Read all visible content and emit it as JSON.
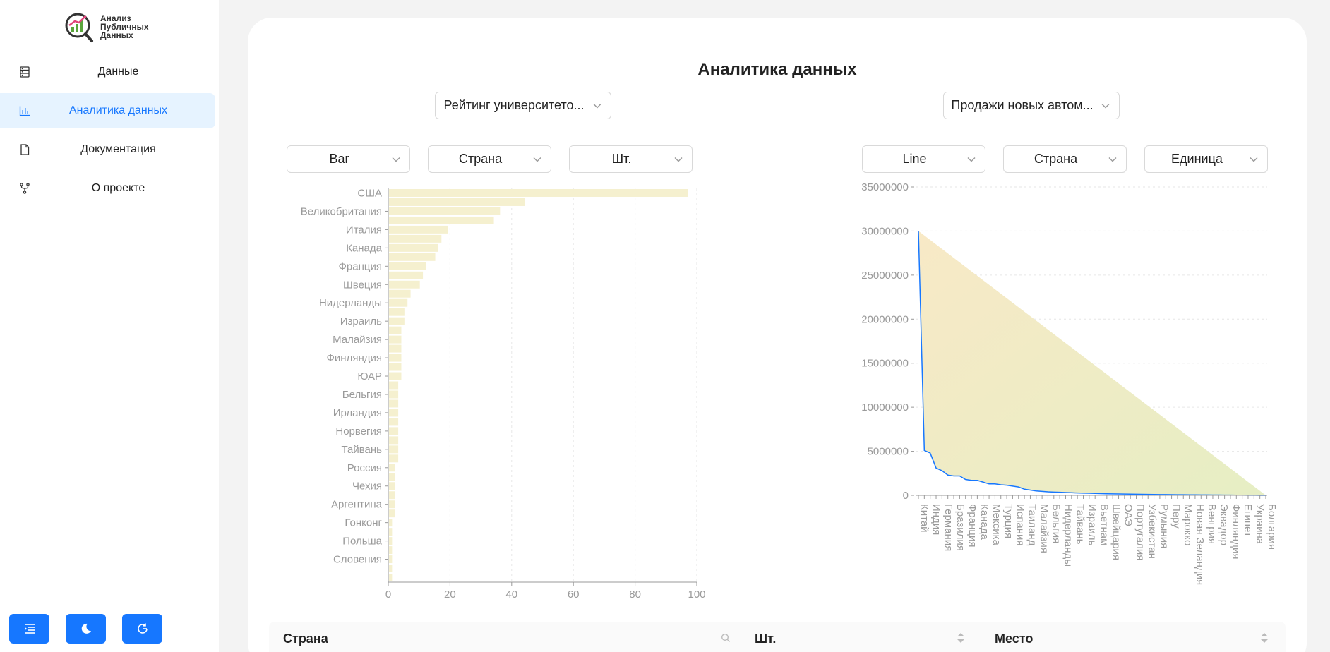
{
  "sidebar": {
    "logo_lines": [
      "Анализ",
      "Публичных",
      "Данных"
    ],
    "items": [
      {
        "label": "Данные",
        "icon": "database-icon",
        "active": false
      },
      {
        "label": "Аналитика данных",
        "icon": "bar-chart-icon",
        "active": true
      },
      {
        "label": "Документация",
        "icon": "file-icon",
        "active": false
      },
      {
        "label": "О проекте",
        "icon": "fork-icon",
        "active": false
      }
    ],
    "buttons": [
      {
        "icon": "menu-fold-icon"
      },
      {
        "icon": "moon-icon"
      },
      {
        "icon": "refresh-icon"
      }
    ]
  },
  "page": {
    "title": "Аналитика данных"
  },
  "left_panel": {
    "dataset_select": "Рейтинг университето...",
    "chart_type_select": "Bar",
    "group_select": "Страна",
    "unit_select": "Шт."
  },
  "right_panel": {
    "dataset_select": "Продажи новых автом...",
    "chart_type_select": "Line",
    "group_select": "Страна",
    "unit_select": "Единица"
  },
  "table": {
    "columns": [
      "Страна",
      "Шт.",
      "Место"
    ]
  },
  "colors": {
    "accent": "#1677ff",
    "fill": "#f5f0cf",
    "active_bg": "#e6f3ff"
  },
  "chart_data": [
    {
      "type": "bar",
      "orientation": "horizontal",
      "categories": [
        "США",
        "",
        "Великобритания",
        "",
        "Италия",
        "",
        "Канада",
        "",
        "Франция",
        "",
        "Швеция",
        "",
        "Нидерланды",
        "",
        "Израиль",
        "",
        "Малайзия",
        "",
        "Финляндия",
        "",
        "ЮАР",
        "",
        "Бельгия",
        "",
        "Ирландия",
        "",
        "Норвегия",
        "",
        "Тайвань",
        "",
        "Россия",
        "",
        "Чехия",
        "",
        "Аргентина",
        "",
        "Гонконг",
        "",
        "Польша",
        "",
        "Словения",
        ""
      ],
      "values": [
        97,
        44,
        36,
        34,
        19,
        17,
        16,
        15,
        12,
        11,
        10,
        7,
        6,
        5,
        5,
        4,
        4,
        4,
        4,
        4,
        4,
        3,
        3,
        3,
        3,
        3,
        3,
        3,
        3,
        3,
        2,
        2,
        2,
        2,
        2,
        2,
        1,
        1,
        1,
        1,
        1,
        1,
        1
      ],
      "xticks": [
        0,
        20,
        40,
        60,
        80,
        100
      ],
      "xlim": [
        0,
        100
      ],
      "grid": true
    },
    {
      "type": "area",
      "categories": [
        "Китай",
        "Индия",
        "Германия",
        "Бразилия",
        "Франция",
        "Канада",
        "Мексика",
        "Турция",
        "Испания",
        "Таиланд",
        "Малайзия",
        "Бельгия",
        "Нидерланды",
        "Тайвань",
        "Израиль",
        "Вьетнам",
        "Швейцария",
        "ОАЭ",
        "Португалия",
        "Узбекистан",
        "Румыния",
        "Перу",
        "Марокко",
        "Новая Зеландия",
        "Венгрия",
        "Эквадор",
        "Финляндия",
        "Египет",
        "Украина",
        "Болгария"
      ],
      "values": [
        30000000,
        5100000,
        4800000,
        3100000,
        2800000,
        2300000,
        2200000,
        2200000,
        1800000,
        1700000,
        1700000,
        1500000,
        1300000,
        1300000,
        1200000,
        1150000,
        1050000,
        950000,
        700000,
        600000,
        500000,
        450000,
        400000,
        370000,
        350000,
        320000,
        300000,
        270000,
        250000,
        240000,
        220000,
        200000,
        180000,
        170000,
        160000,
        150000,
        140000,
        130000,
        120000,
        110000,
        100000,
        95000,
        90000,
        80000,
        75000,
        70000,
        65000,
        60000,
        55000,
        50000,
        45000,
        40000,
        35000,
        30000,
        25000,
        20000,
        15000,
        10000,
        5000,
        2000
      ],
      "yticks": [
        0,
        5000000,
        10000000,
        15000000,
        20000000,
        25000000,
        30000000,
        35000000
      ],
      "ylim": [
        0,
        35000000
      ],
      "grid": true
    }
  ]
}
